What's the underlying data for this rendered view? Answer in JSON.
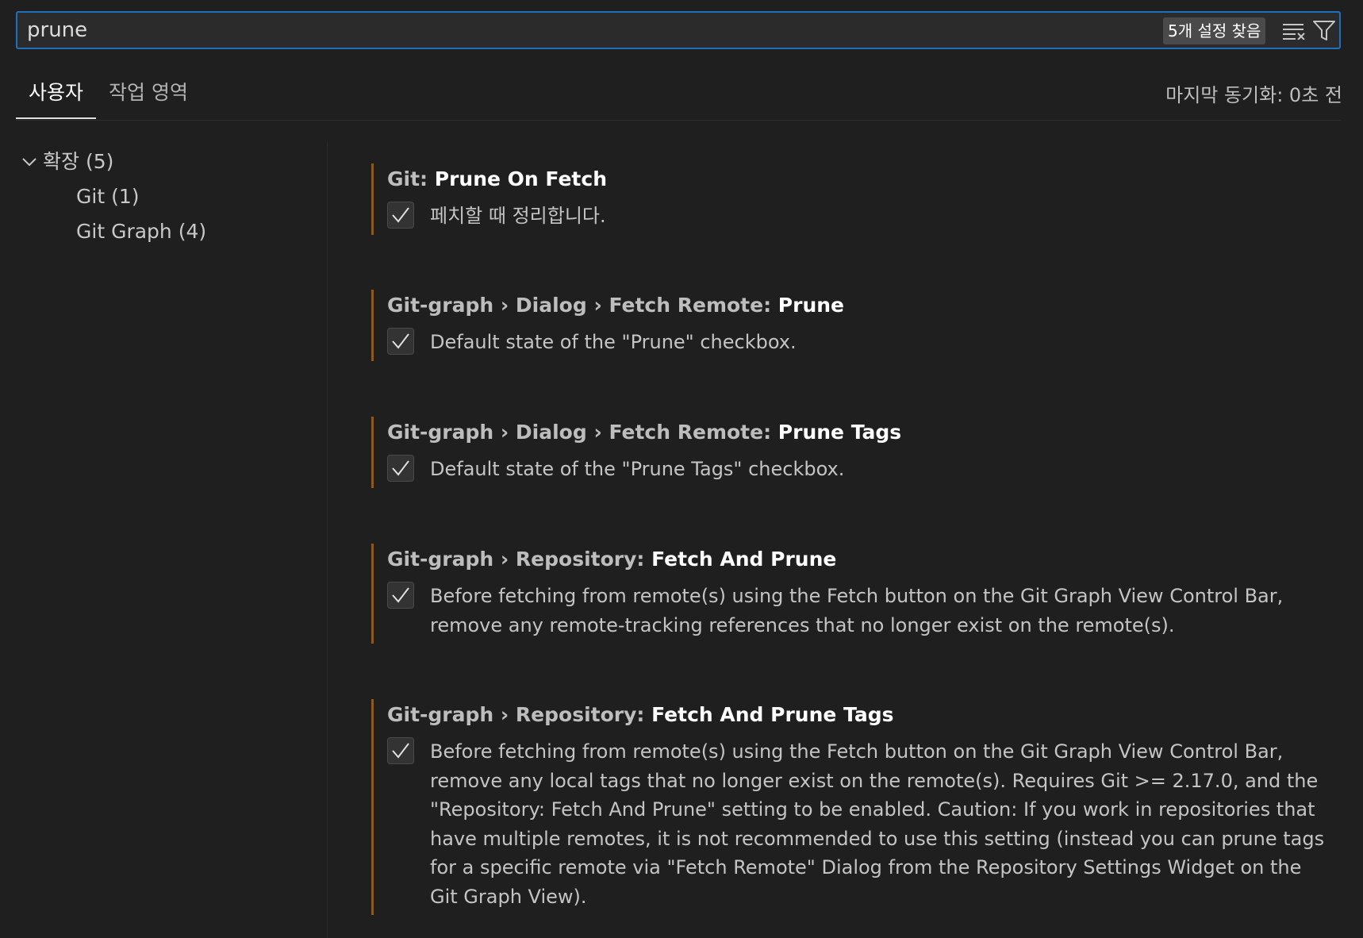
{
  "search": {
    "value": "prune",
    "result_count": "5개 설정 찾음"
  },
  "tabs": [
    {
      "label": "사용자",
      "active": true
    },
    {
      "label": "작업 영역",
      "active": false
    }
  ],
  "sync_status": "마지막 동기화: 0초 전",
  "toc": {
    "group": "확장 (5)",
    "items": [
      {
        "label": "Git (1)"
      },
      {
        "label": "Git Graph (4)"
      }
    ]
  },
  "settings": [
    {
      "prefix": "Git: ",
      "key": "Prune On Fetch",
      "checked": true,
      "description": "페치할 때 정리합니다."
    },
    {
      "prefix": "Git-graph › Dialog › Fetch Remote: ",
      "key": "Prune",
      "checked": true,
      "description": "Default state of the \"Prune\" checkbox."
    },
    {
      "prefix": "Git-graph › Dialog › Fetch Remote: ",
      "key": "Prune Tags",
      "checked": true,
      "description": "Default state of the \"Prune Tags\" checkbox."
    },
    {
      "prefix": "Git-graph › Repository: ",
      "key": "Fetch And Prune",
      "checked": true,
      "description": "Before fetching from remote(s) using the Fetch button on the Git Graph View Control Bar, remove any remote-tracking references that no longer exist on the remote(s)."
    },
    {
      "prefix": "Git-graph › Repository: ",
      "key": "Fetch And Prune Tags",
      "checked": true,
      "description": "Before fetching from remote(s) using the Fetch button on the Git Graph View Control Bar, remove any local tags that no longer exist on the remote(s). Requires Git >= 2.17.0, and the \"Repository: Fetch And Prune\" setting to be enabled. Caution: If you work in repositories that have multiple remotes, it is not recommended to use this setting (instead you can prune tags for a specific remote via \"Fetch Remote\" Dialog from the Repository Settings Widget on the Git Graph View)."
    }
  ],
  "colors": {
    "background": "#1f1f1f",
    "focus_border": "#1f6fbf",
    "modified_bar": "#8a5a1f"
  },
  "icons": {
    "clear_filters": "clear-all-icon",
    "filter": "filter-icon",
    "group_chevron": "chevron-down-icon",
    "check": "check-icon"
  }
}
